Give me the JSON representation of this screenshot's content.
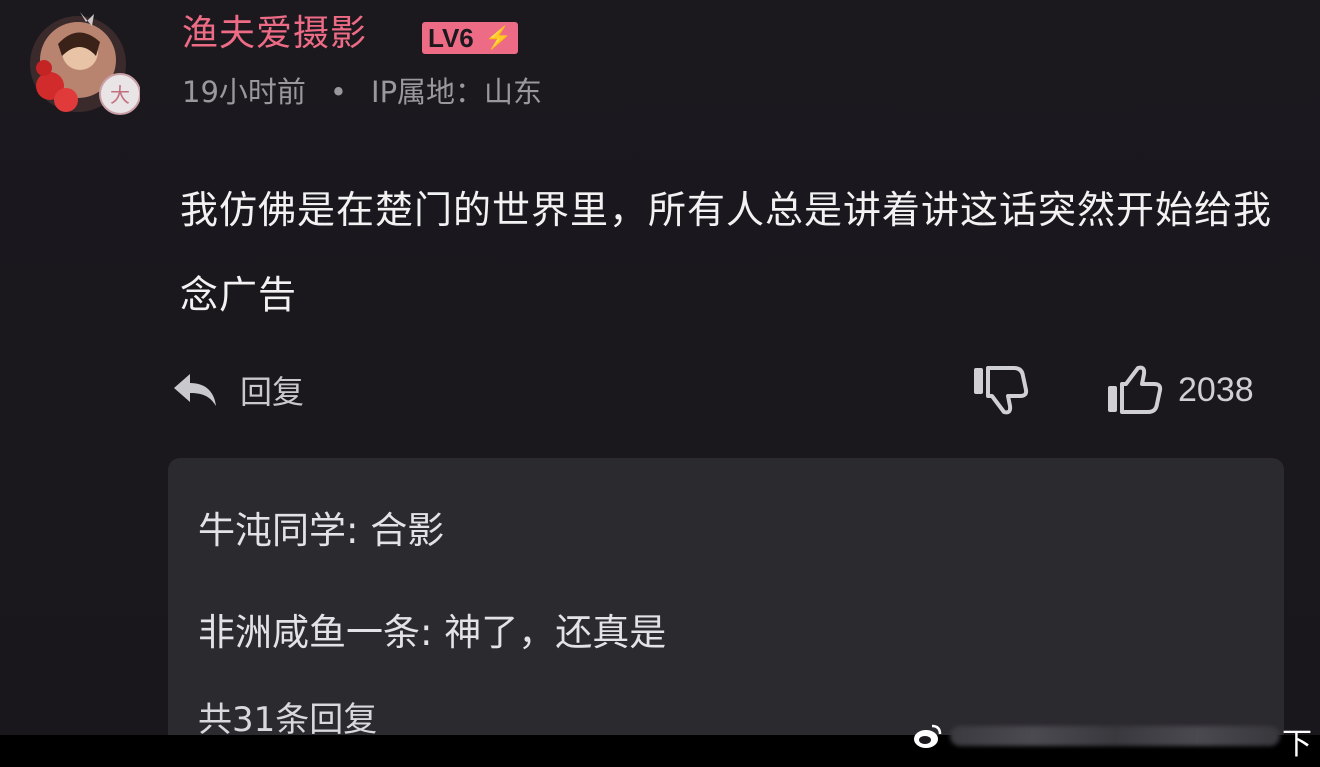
{
  "post": {
    "username": "渔夫爱摄影",
    "level_badge": "LV6",
    "time_ago": "19小时前",
    "separator": "•",
    "ip_location": "IP属地：山东",
    "comment_text": "我仿佛是在楚门的世界里，所有人总是讲着讲这话突然开始给我念广告"
  },
  "actions": {
    "reply_label": "回复",
    "like_count": "2038",
    "reply_icon": "reply-arrow-icon",
    "dislike_icon": "thumbs-down-icon",
    "like_icon": "thumbs-up-icon"
  },
  "replies": {
    "items": [
      {
        "text": "牛沌同学: 合影"
      },
      {
        "text": "非洲咸鱼一条: 神了，还真是"
      }
    ],
    "total_label": "共31条回复"
  },
  "footer": {
    "corner_glyph": "下",
    "watermark_icon": "weibo-logo-icon"
  },
  "colors": {
    "background": "#1b191e",
    "username": "#ee6b86",
    "reply_panel": "#2b2a2e",
    "meta_text": "#9a989d"
  }
}
